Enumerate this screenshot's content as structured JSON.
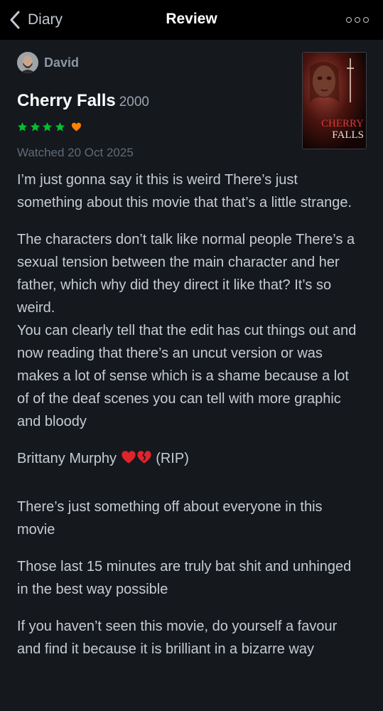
{
  "header": {
    "back_label": "Diary",
    "title": "Review"
  },
  "user": {
    "name": "David"
  },
  "movie": {
    "title": "Cherry Falls",
    "year": "2000",
    "poster_text_line1": "CHERRY",
    "poster_text_line2": "FALLS"
  },
  "rating": {
    "stars": 4,
    "max_stars": 5,
    "liked": true,
    "star_color": "#00c030",
    "heart_color": "#ff8000"
  },
  "watched": "Watched 20 Oct 2025",
  "review": {
    "p1": "I’m just gonna say it this is weird There’s just something about this movie that that’s a little strange.",
    "p2a": "The characters don’t talk like normal people There’s a sexual tension between the main character and her father, which why did they direct it like that? It’s so weird.",
    "p2b": "You can clearly tell that the edit has cut things out and now reading that there’s an uncut version or was makes a lot of sense which is a shame because a lot of of the deaf scenes you can tell with more graphic and bloody",
    "p3_prefix": "Brittany Murphy",
    "p3_suffix": "(RIP)",
    "p4": "There’s just something off about everyone in this movie",
    "p5": "Those last 15 minutes are truly bat shit and unhinged in the best way possible",
    "p6": "If you haven’t seen this movie, do yourself a favour and find it because it is brilliant in a bizarre way"
  },
  "colors": {
    "background": "#15181d",
    "header_background": "#000000",
    "body_text": "#c6ccd3",
    "muted_text": "#5f6b77"
  }
}
